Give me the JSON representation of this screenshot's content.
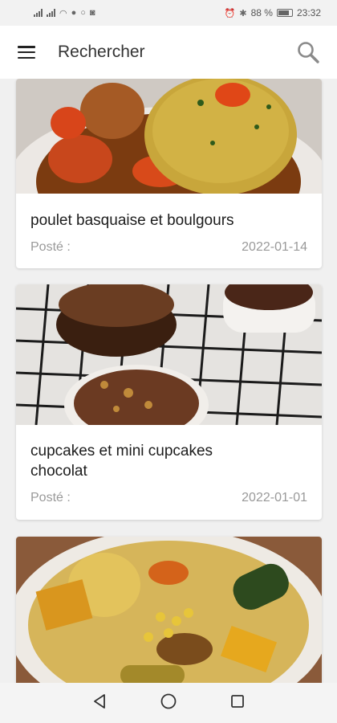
{
  "status_bar": {
    "battery": "88 %",
    "time": "23:32"
  },
  "app_bar": {
    "title": "Rechercher",
    "menu_icon": "menu-icon",
    "search_icon": "search-icon"
  },
  "posts": [
    {
      "title": "poulet basquaise et boulgours",
      "posted_label": "Posté :",
      "date": "2022-01-14"
    },
    {
      "title": "cupcakes et mini cupcakes chocolat",
      "posted_label": "Posté :",
      "date": "2022-01-01"
    },
    {
      "title": "",
      "posted_label": "",
      "date": ""
    }
  ],
  "nav_bar": {
    "back_icon": "back-icon",
    "home_icon": "home-icon",
    "recents_icon": "recents-icon"
  },
  "colors": {
    "background": "#f0f0f0",
    "card": "#ffffff",
    "meta_text": "#999999"
  }
}
